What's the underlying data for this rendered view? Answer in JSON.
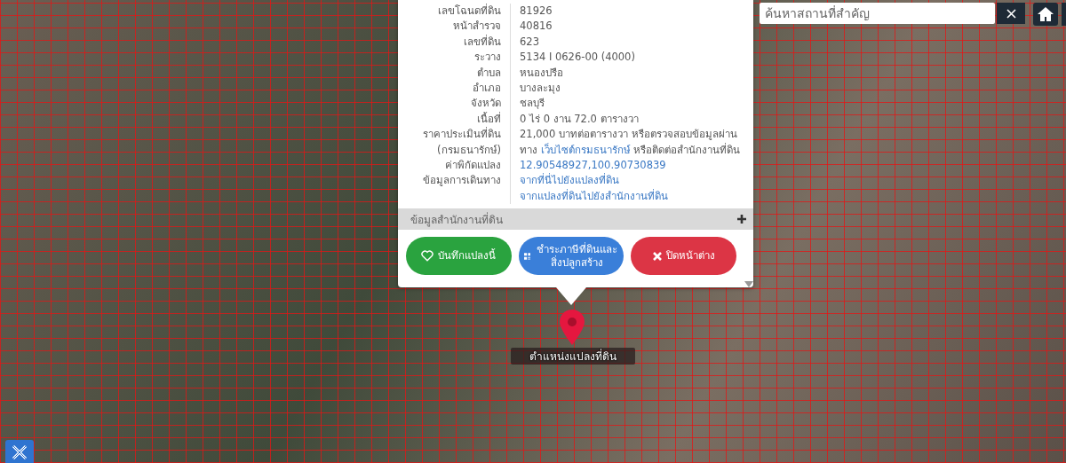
{
  "popup": {
    "rows": [
      {
        "label": [
          "เลขโฉนดที่ดิน"
        ],
        "lines": [
          [
            {
              "text": "81926",
              "link": false
            }
          ]
        ]
      },
      {
        "label": [
          "หน้าสำรวจ"
        ],
        "lines": [
          [
            {
              "text": "40816",
              "link": false
            }
          ]
        ]
      },
      {
        "label": [
          "เลขที่ดิน"
        ],
        "lines": [
          [
            {
              "text": "623",
              "link": false
            }
          ]
        ]
      },
      {
        "label": [
          "ระวาง"
        ],
        "lines": [
          [
            {
              "text": "5134 I 0626-00 (4000)",
              "link": false
            }
          ]
        ]
      },
      {
        "label": [
          "ตำบล"
        ],
        "lines": [
          [
            {
              "text": "หนองปรือ",
              "link": false
            }
          ]
        ]
      },
      {
        "label": [
          "อำเภอ"
        ],
        "lines": [
          [
            {
              "text": "บางละมุง",
              "link": false
            }
          ]
        ]
      },
      {
        "label": [
          "จังหวัด"
        ],
        "lines": [
          [
            {
              "text": "ชลบุรี",
              "link": false
            }
          ]
        ]
      },
      {
        "label": [
          "เนื้อที่"
        ],
        "lines": [
          [
            {
              "text": "0 ไร่ 0 งาน 72.0 ตารางวา",
              "link": false
            }
          ]
        ]
      },
      {
        "label": [
          "ราคาประเมินที่ดิน",
          "(กรมธนารักษ์)"
        ],
        "lines": [
          [
            {
              "text": "21,000 บาทต่อตารางวา หรือตรวจสอบข้อมูลผ่าน ทาง ",
              "link": false
            },
            {
              "text": "เว็บไซต์กรมธนารักษ์",
              "link": true
            },
            {
              "text": " หรือติดต่อสำนักงานที่ดิน",
              "link": false
            }
          ]
        ]
      },
      {
        "label": [
          "ค่าพิกัดแปลง"
        ],
        "lines": [
          [
            {
              "text": "12.90548927,100.90730839",
              "link": true
            }
          ]
        ]
      },
      {
        "label": [
          "ข้อมูลการเดินทาง"
        ],
        "lines": [
          [
            {
              "text": "จากที่นี่ไปยังแปลงที่ดิน",
              "link": true
            }
          ],
          [
            {
              "text": "จากแปลงที่ดินไปยังสำนักงานที่ดิน",
              "link": true
            }
          ]
        ]
      }
    ],
    "section": {
      "title": "ข้อมูลสำนักงานที่ดิน",
      "expanded": false
    },
    "buttons": [
      {
        "kind": "save",
        "label": "บันทึกแปลงนี้"
      },
      {
        "kind": "pay",
        "label": "ชำระภาษีที่ดินและสิ่งปลูกสร้าง"
      },
      {
        "kind": "close",
        "label": "ปิดหน้าต่าง"
      }
    ]
  },
  "marker": {
    "label": "ตำแหน่งแปลงที่ดิน"
  },
  "search": {
    "placeholder": "ค้นหาสถานที่สำคัญ"
  }
}
